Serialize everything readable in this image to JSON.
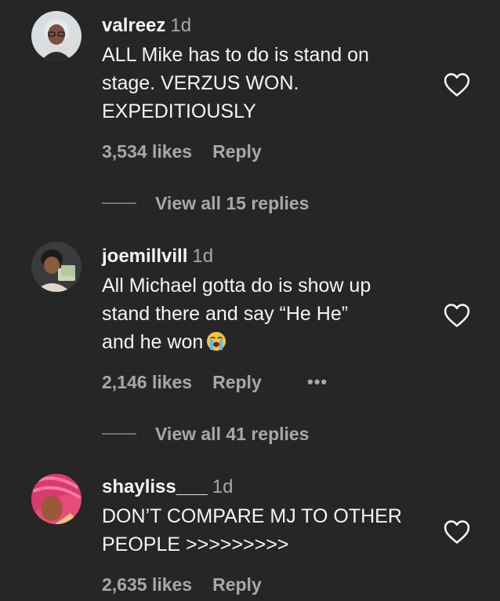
{
  "comments": [
    {
      "username": "valreez",
      "time": "1d",
      "text": "ALL Mike has to do is stand on stage. VERZUS WON. EXPEDITIOUSLY",
      "text_lines": [
        "ALL Mike has to do is stand on",
        "stage. VERZUS WON.",
        "EXPEDITIOUSLY"
      ],
      "likes": "3,534 likes",
      "reply_label": "Reply",
      "view_replies": "View all 15 replies"
    },
    {
      "username": "joemillvill",
      "time": "1d",
      "text_lines": [
        "All Michael gotta do is show up",
        "stand there and say “He He”",
        "and he won"
      ],
      "emoji": "loudly-crying-face",
      "likes": "2,146 likes",
      "reply_label": "Reply",
      "more_label": "•••",
      "view_replies": "View all 41 replies"
    },
    {
      "username": "shayliss___",
      "time": "1d",
      "text_lines": [
        "DON’T COMPARE MJ TO OTHER",
        "PEOPLE >>>>>>>>>"
      ],
      "likes": "2,635 likes",
      "reply_label": "Reply"
    }
  ],
  "icons": {
    "like": "heart-outline-icon",
    "more": "more-options-icon"
  },
  "colors": {
    "background": "#262626",
    "primary_text": "#f5f5f5",
    "secondary_text": "#a8a8a8"
  }
}
